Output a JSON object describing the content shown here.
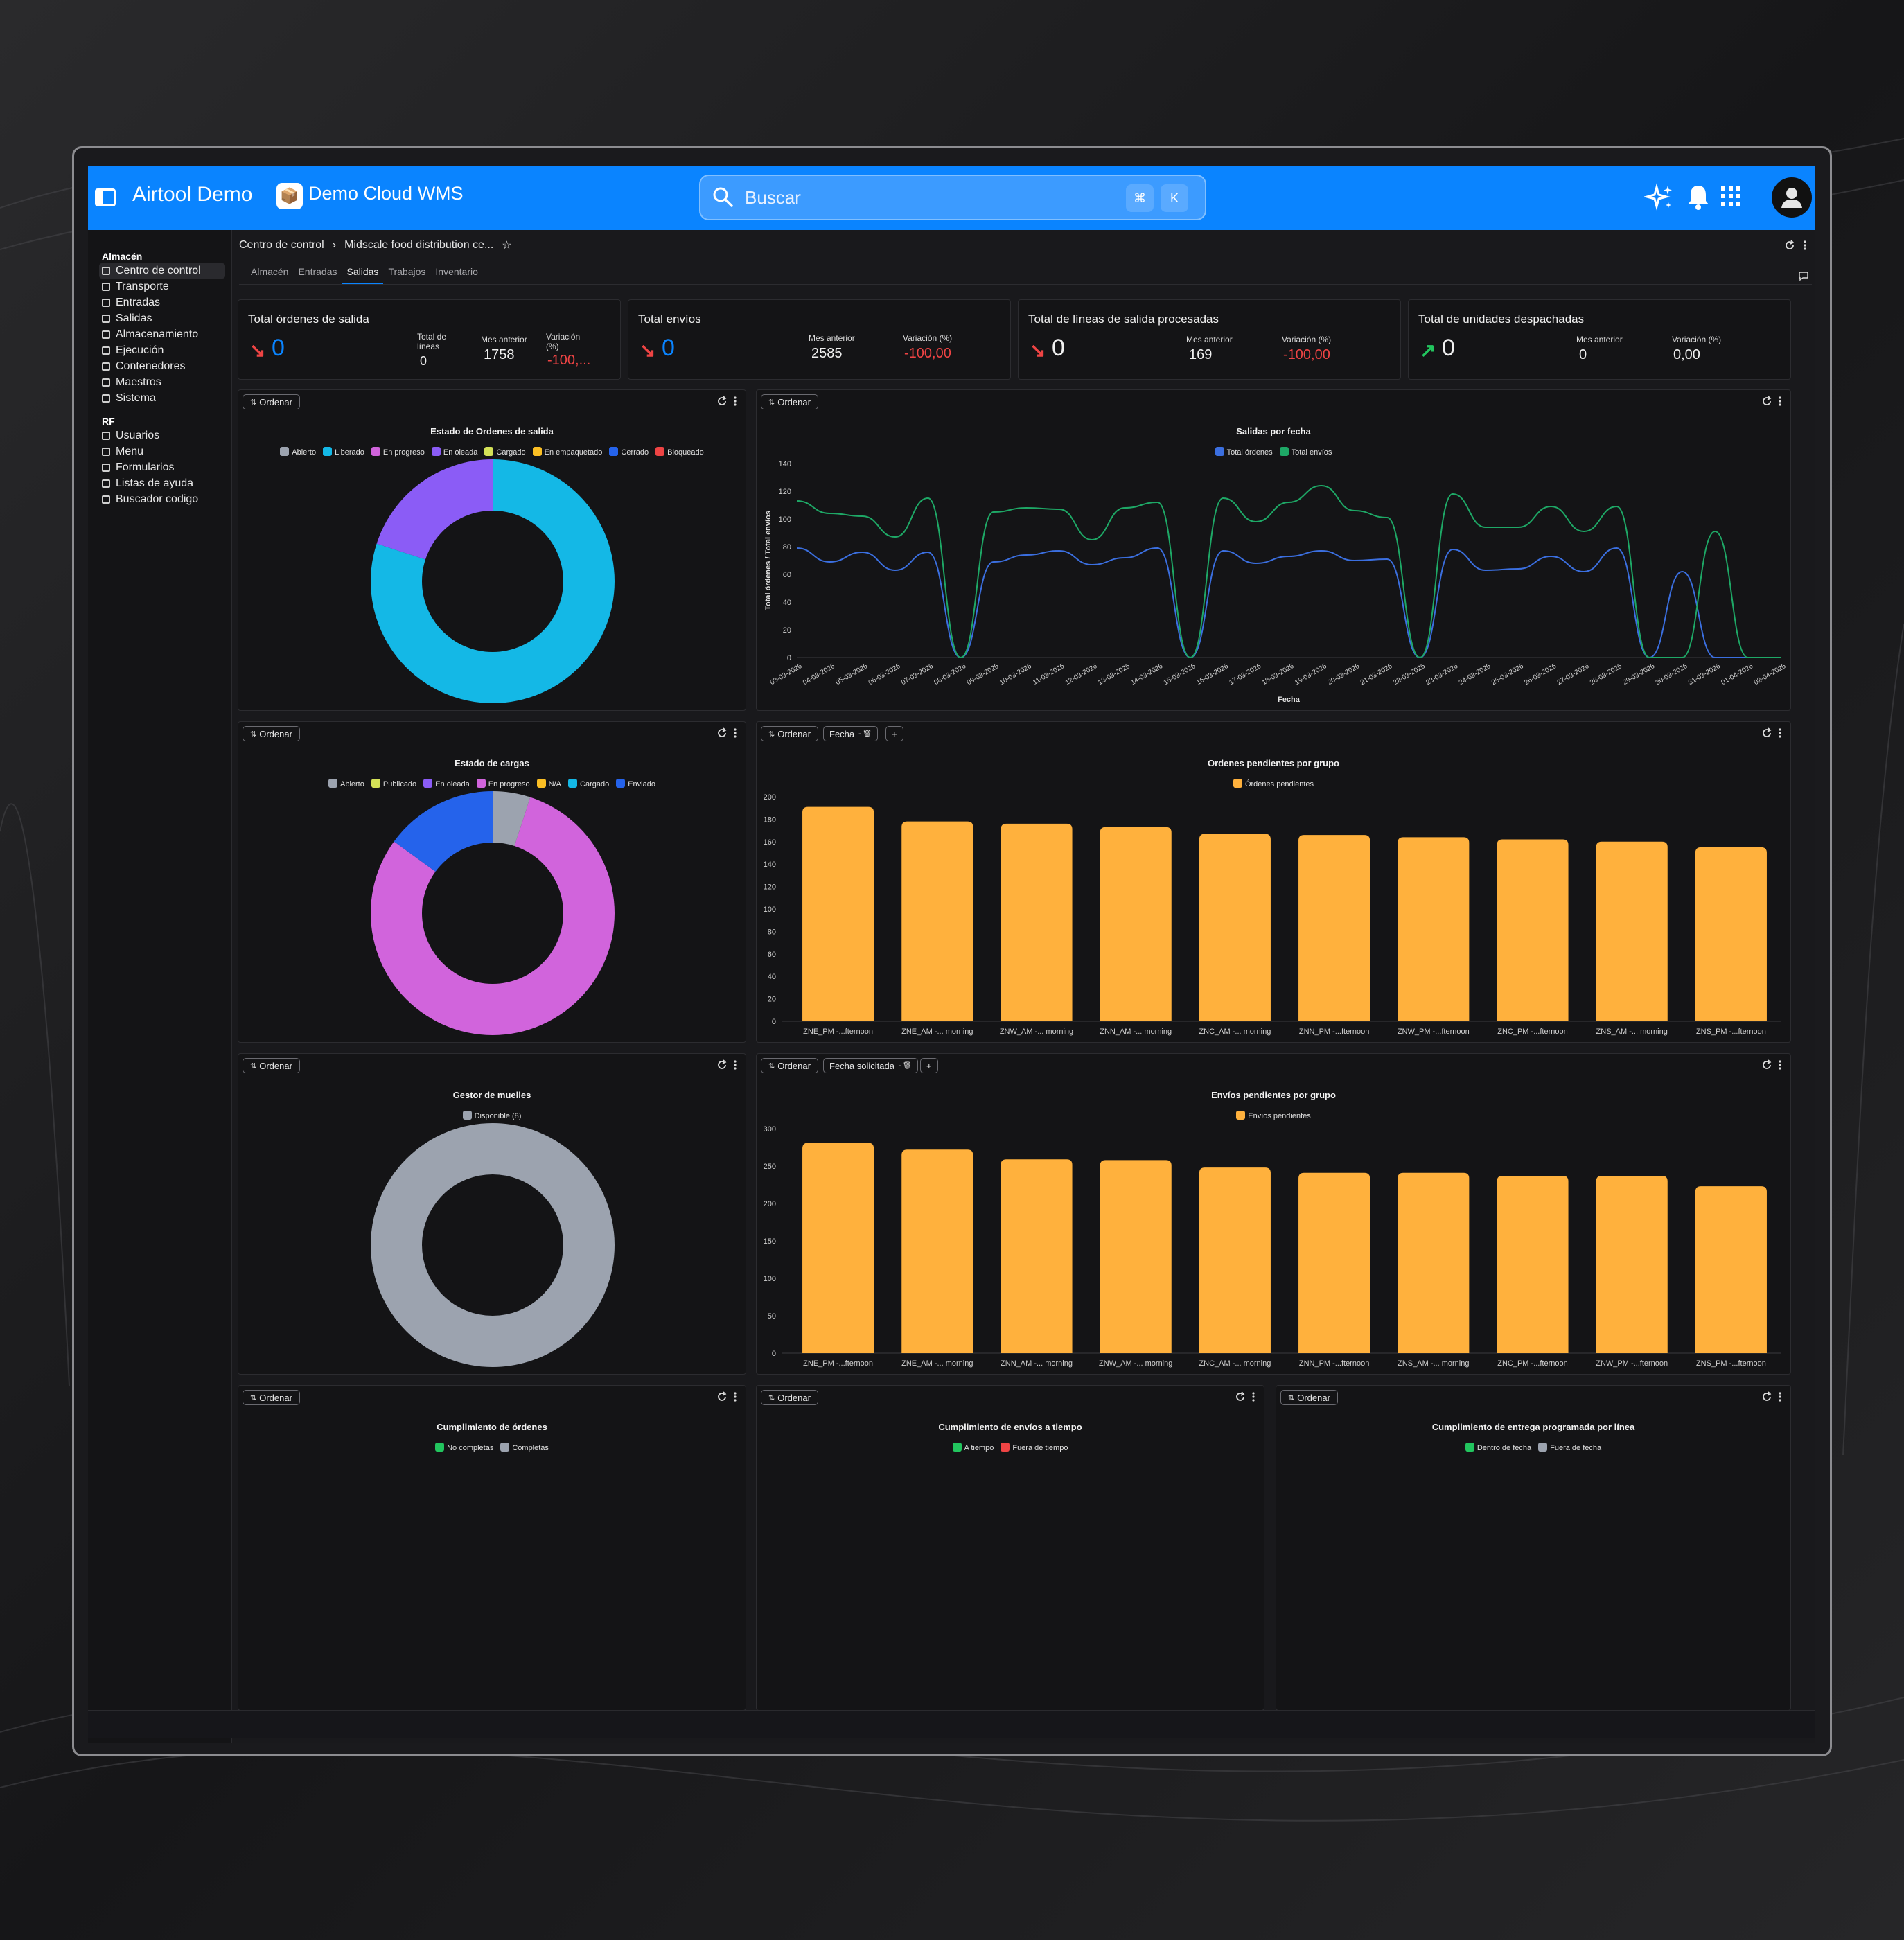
{
  "app": {
    "title": "Airtool Demo",
    "workspace": "Demo Cloud WMS"
  },
  "search": {
    "placeholder": "Buscar",
    "kbd1": "⌘",
    "kbd2": "K"
  },
  "sidebar": {
    "section1": "Almacén",
    "items1": [
      {
        "label": "Centro de control",
        "active": true
      },
      {
        "label": "Transporte"
      },
      {
        "label": "Entradas"
      },
      {
        "label": "Salidas"
      },
      {
        "label": "Almacenamiento"
      },
      {
        "label": "Ejecución"
      },
      {
        "label": "Contenedores"
      },
      {
        "label": "Maestros"
      },
      {
        "label": "Sistema"
      }
    ],
    "section2": "RF",
    "items2": [
      {
        "label": "Usuarios"
      },
      {
        "label": "Menu"
      },
      {
        "label": "Formularios"
      },
      {
        "label": "Listas de ayuda"
      },
      {
        "label": "Buscador codigo"
      }
    ]
  },
  "breadcrumb": {
    "root": "Centro de control",
    "separator": "›",
    "current": "Midscale food distribution ce...",
    "star": "☆"
  },
  "tabs": [
    "Almacén",
    "Entradas",
    "Salidas",
    "Trabajos",
    "Inventario"
  ],
  "active_tab": "Salidas",
  "kpis": [
    {
      "title": "Total órdenes de salida",
      "value": "0",
      "trend": "down",
      "col1_label": "Total de líneas",
      "col1_value": "0",
      "col2_label": "Mes anterior",
      "col2_value": "1758",
      "col3_label": "Variación (%)",
      "col3_value": "-100,..."
    },
    {
      "title": "Total envíos",
      "value": "0",
      "trend": "down",
      "col2_label": "Mes anterior",
      "col2_value": "2585",
      "col3_label": "Variación (%)",
      "col3_value": "-100,00"
    },
    {
      "title": "Total de líneas de salida procesadas",
      "value": "0",
      "trend": "down",
      "col2_label": "Mes anterior",
      "col2_value": "169",
      "col3_label": "Variación (%)",
      "col3_value": "-100,00"
    },
    {
      "title": "Total de unidades despachadas",
      "value": "0",
      "trend": "up",
      "col2_label": "Mes anterior",
      "col2_value": "0",
      "col3_label": "Variación (%)",
      "col3_value": "0,00"
    }
  ],
  "controls": {
    "order": "Ordenar",
    "filter_fecha": "Fecha",
    "filter_fecha_sol": "Fecha solicitada",
    "add": "+"
  },
  "colors": {
    "accent": "#0a84ff",
    "orange": "#ffb13d",
    "down": "#ef4444",
    "up": "#22c55e"
  },
  "chart_data": [
    {
      "id": "estado-ordenes",
      "type": "pie",
      "title": "Estado de Ordenes de salida",
      "legend": [
        {
          "name": "Abierto",
          "color": "#9ca3af"
        },
        {
          "name": "Liberado",
          "color": "#14b8e6"
        },
        {
          "name": "En progreso",
          "color": "#d164dc"
        },
        {
          "name": "En oleada",
          "color": "#8b5cf6"
        },
        {
          "name": "Cargado",
          "color": "#d4e157"
        },
        {
          "name": "En empaquetado",
          "color": "#fbbf24"
        },
        {
          "name": "Cerrado",
          "color": "#2563eb"
        },
        {
          "name": "Bloqueado",
          "color": "#ef4444"
        }
      ],
      "slices": [
        {
          "name": "Liberado",
          "value": 80,
          "color": "#14b8e6"
        },
        {
          "name": "En oleada",
          "value": 20,
          "color": "#8b5cf6"
        }
      ]
    },
    {
      "id": "salidas-fecha",
      "type": "line",
      "title": "Salidas por fecha",
      "xlabel": "Fecha",
      "ylabel": "Total órdenes / Total envíos",
      "ylim": [
        0,
        140
      ],
      "yticks": [
        0,
        20,
        40,
        60,
        80,
        100,
        120,
        140
      ],
      "x": [
        "03-03-2026",
        "04-03-2026",
        "05-03-2026",
        "06-03-2026",
        "07-03-2026",
        "08-03-2026",
        "09-03-2026",
        "10-03-2026",
        "11-03-2026",
        "12-03-2026",
        "13-03-2026",
        "14-03-2026",
        "15-03-2026",
        "16-03-2026",
        "17-03-2026",
        "18-03-2026",
        "19-03-2026",
        "20-03-2026",
        "21-03-2026",
        "22-03-2026",
        "23-03-2026",
        "24-03-2026",
        "25-03-2026",
        "26-03-2026",
        "27-03-2026",
        "28-03-2026",
        "29-03-2026",
        "30-03-2026",
        "31-03-2026",
        "01-04-2026",
        "02-04-2026"
      ],
      "series": [
        {
          "name": "Total órdenes",
          "color": "#3b6fe0",
          "values": [
            79,
            69,
            76,
            63,
            76,
            0,
            69,
            74,
            77,
            67,
            72,
            79,
            0,
            77,
            68,
            73,
            77,
            70,
            71,
            0,
            78,
            63,
            64,
            73,
            62,
            79,
            0,
            62,
            0,
            0,
            0
          ]
        },
        {
          "name": "Total envíos",
          "color": "#1ea866",
          "values": [
            113,
            104,
            102,
            87,
            115,
            0,
            105,
            108,
            107,
            85,
            108,
            112,
            0,
            115,
            98,
            112,
            124,
            106,
            101,
            0,
            118,
            94,
            94,
            109,
            91,
            109,
            0,
            0,
            91,
            0,
            0
          ]
        }
      ]
    },
    {
      "id": "estado-cargas",
      "type": "pie",
      "title": "Estado de cargas",
      "legend": [
        {
          "name": "Abierto",
          "color": "#9ca3af"
        },
        {
          "name": "Publicado",
          "color": "#d4e157"
        },
        {
          "name": "En oleada",
          "color": "#8b5cf6"
        },
        {
          "name": "En progreso",
          "color": "#d164dc"
        },
        {
          "name": "N/A",
          "color": "#fbbf24"
        },
        {
          "name": "Cargado",
          "color": "#14b8e6"
        },
        {
          "name": "Enviado",
          "color": "#2563eb"
        }
      ],
      "slices": [
        {
          "name": "Abierto",
          "value": 5,
          "color": "#9ca3af"
        },
        {
          "name": "En progreso",
          "value": 80,
          "color": "#d164dc"
        },
        {
          "name": "Enviado",
          "value": 15,
          "color": "#2563eb"
        }
      ]
    },
    {
      "id": "ordenes-pendientes",
      "type": "bar",
      "title": "Ordenes pendientes por grupo",
      "series_name": "Órdenes pendientes",
      "ylim": [
        0,
        200
      ],
      "yticks": [
        0,
        20,
        40,
        60,
        80,
        100,
        120,
        140,
        160,
        180,
        200
      ],
      "categories": [
        "ZNE_PM -...fternoon",
        "ZNE_AM -... morning",
        "ZNW_AM -... morning",
        "ZNN_AM -... morning",
        "ZNC_AM -... morning",
        "ZNN_PM -...fternoon",
        "ZNW_PM -...fternoon",
        "ZNC_PM -...fternoon",
        "ZNS_AM -... morning",
        "ZNS_PM -...fternoon"
      ],
      "values": [
        191,
        178,
        176,
        173,
        167,
        166,
        164,
        162,
        160,
        155
      ]
    },
    {
      "id": "gestor-muelles",
      "type": "pie",
      "title": "Gestor de muelles",
      "legend": [
        {
          "name": "Disponible (8)",
          "color": "#9ca3af"
        }
      ],
      "slices": [
        {
          "name": "Disponible",
          "value": 8,
          "color": "#9ca3af"
        }
      ]
    },
    {
      "id": "envios-pendientes",
      "type": "bar",
      "title": "Envíos pendientes por grupo",
      "series_name": "Envíos pendientes",
      "ylim": [
        0,
        300
      ],
      "yticks": [
        0,
        50,
        100,
        150,
        200,
        250,
        300
      ],
      "categories": [
        "ZNE_PM -...fternoon",
        "ZNE_AM -... morning",
        "ZNN_AM -... morning",
        "ZNW_AM -... morning",
        "ZNC_AM -... morning",
        "ZNN_PM -...fternoon",
        "ZNS_AM -... morning",
        "ZNC_PM -...fternoon",
        "ZNW_PM -...fternoon",
        "ZNS_PM -...fternoon"
      ],
      "values": [
        281,
        272,
        259,
        258,
        248,
        241,
        241,
        237,
        237,
        223
      ]
    },
    {
      "id": "cumpl-ordenes",
      "type": "pie",
      "title": "Cumplimiento de órdenes",
      "legend": [
        {
          "name": "No completas",
          "color": "#22c55e"
        },
        {
          "name": "Completas",
          "color": "#9ca3af"
        }
      ],
      "slices": []
    },
    {
      "id": "cumpl-envios",
      "type": "pie",
      "title": "Cumplimiento de envíos a tiempo",
      "legend": [
        {
          "name": "A tiempo",
          "color": "#22c55e"
        },
        {
          "name": "Fuera de tiempo",
          "color": "#ef4444"
        }
      ],
      "slices": []
    },
    {
      "id": "cumpl-entrega",
      "type": "pie",
      "title": "Cumplimiento de entrega programada por línea",
      "legend": [
        {
          "name": "Dentro de fecha",
          "color": "#22c55e"
        },
        {
          "name": "Fuera de fecha",
          "color": "#9ca3af"
        }
      ],
      "slices": []
    }
  ]
}
